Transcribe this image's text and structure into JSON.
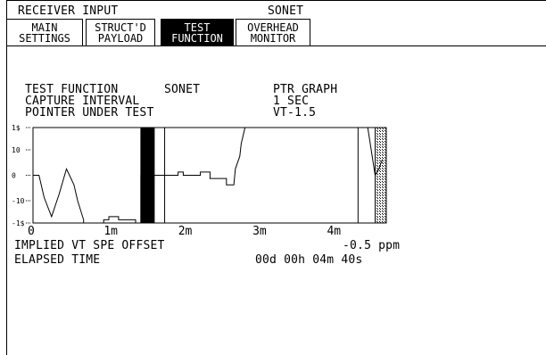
{
  "header": {
    "title": "RECEIVER INPUT",
    "mode": "SONET"
  },
  "tabs": [
    {
      "line1": "MAIN",
      "line2": "SETTINGS",
      "active": false
    },
    {
      "line1": "STRUCT'D",
      "line2": "PAYLOAD",
      "active": false
    },
    {
      "line1": "TEST",
      "line2": "FUNCTION",
      "active": true
    },
    {
      "line1": "OVERHEAD",
      "line2": "MONITOR",
      "active": false
    }
  ],
  "info": {
    "test_function_label": "TEST FUNCTION",
    "test_function_value": "SONET",
    "test_function_result": "PTR GRAPH",
    "capture_interval_label": "CAPTURE INTERVAL",
    "capture_interval_value": "1 SEC",
    "pointer_label": "POINTER UNDER TEST",
    "pointer_value": "VT-1.5"
  },
  "chart_data": {
    "type": "line",
    "yticks": [
      "1$",
      "10",
      "0",
      "-10",
      "-1$"
    ],
    "xticks": [
      "0",
      "1m",
      "2m",
      "3m",
      "4m"
    ],
    "ylim": [
      -15,
      15
    ],
    "xlim": [
      0,
      4.75
    ],
    "series": [
      {
        "x": [
          0,
          0.08,
          0.08,
          0.15,
          0.25,
          0.35,
          0.45,
          0.55,
          0.6,
          0.68,
          0.68,
          0.95,
          0.95,
          1.02,
          1.02,
          1.15,
          1.15,
          1.38,
          1.38,
          1.45,
          1.45,
          1.55,
          1.55,
          1.95,
          1.95,
          2.02,
          2.02,
          2.25,
          2.25,
          2.38,
          2.38,
          2.6,
          2.6,
          2.7,
          2.72,
          2.75,
          2.78,
          2.8,
          2.82,
          2.85,
          2.85,
          4.5,
          4.5,
          4.6,
          4.6,
          4.65,
          4.68,
          4.7
        ],
        "y": [
          0,
          0,
          0,
          -7,
          -13,
          -6,
          2,
          -3,
          -8,
          -14,
          -15,
          -15,
          -14,
          -14,
          -13,
          -13,
          -14,
          -14,
          -15,
          -15,
          0,
          0,
          0,
          0,
          1,
          1,
          0,
          0,
          1,
          1,
          -1,
          -1,
          -3,
          -3,
          2,
          4,
          6,
          10,
          12,
          15,
          15,
          15,
          15,
          0,
          0,
          2,
          4,
          5
        ]
      }
    ],
    "markers_x": [
      1.77,
      4.37
    ],
    "blocks": [
      {
        "x0": 1.45,
        "x1": 1.63,
        "style": "solid"
      },
      {
        "x0": 4.6,
        "x1": 4.75,
        "style": "hatched"
      }
    ]
  },
  "footer": {
    "offset_label": "IMPLIED VT SPE OFFSET",
    "offset_value": "-0.5 ppm",
    "elapsed_label": "ELAPSED TIME",
    "elapsed_value": "00d 00h 04m 40s"
  },
  "colors": {
    "fg": "#000000",
    "bg": "#ffffff"
  }
}
